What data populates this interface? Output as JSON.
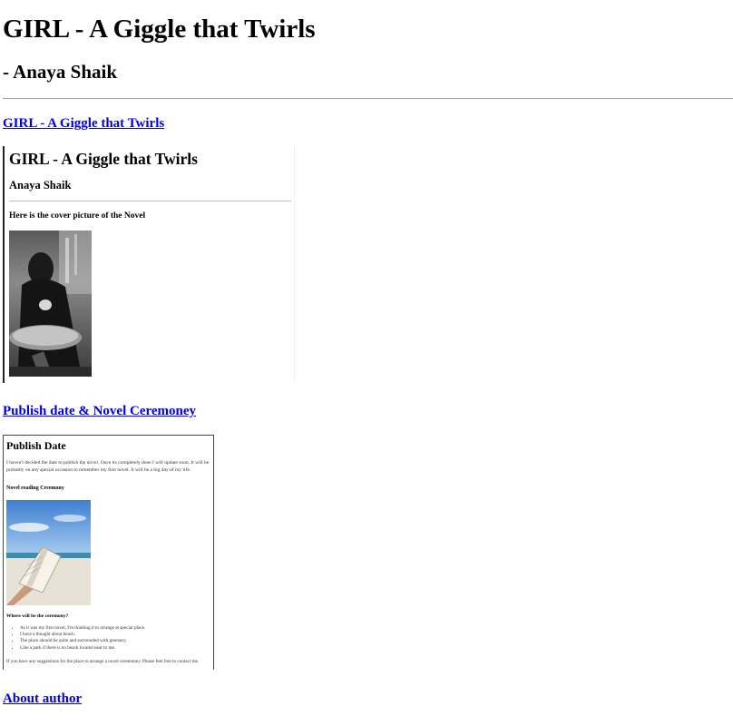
{
  "page": {
    "title": "GIRL - A Giggle that Twirls",
    "author_line": "- Anaya Shaik"
  },
  "links": {
    "novel": "GIRL - A Giggle that Twirls",
    "publish": "Publish date & Novel Ceremoney",
    "about": "About author"
  },
  "frame1": {
    "title": "GIRL - A Giggle that Twirls",
    "author": "Anaya Shaik",
    "caption": "Here is the cover picture of the Novel"
  },
  "frame2": {
    "heading": "Publish Date",
    "paragraph": "I haven't decided the date to publish the novel. Once its completely done I will update soon. It will be probably on any special occasion to remember my first novel. It will be a big day of my life.",
    "subheading": "Novel reading Creemony",
    "question": "Where will be the ceremony?",
    "list": [
      "As it was my first novel, I'm thinking it to arrange at special place.",
      "I have a thought about beach.",
      "The place should be quite and surrounded with greenary.",
      "Like a park if there is no beach located near to me."
    ],
    "footer": "If you have any suggestions for the place to arrange a novel ceremoney. Please feel free to contact me."
  },
  "colors": {
    "link": "#0000ee",
    "text": "#000000"
  }
}
